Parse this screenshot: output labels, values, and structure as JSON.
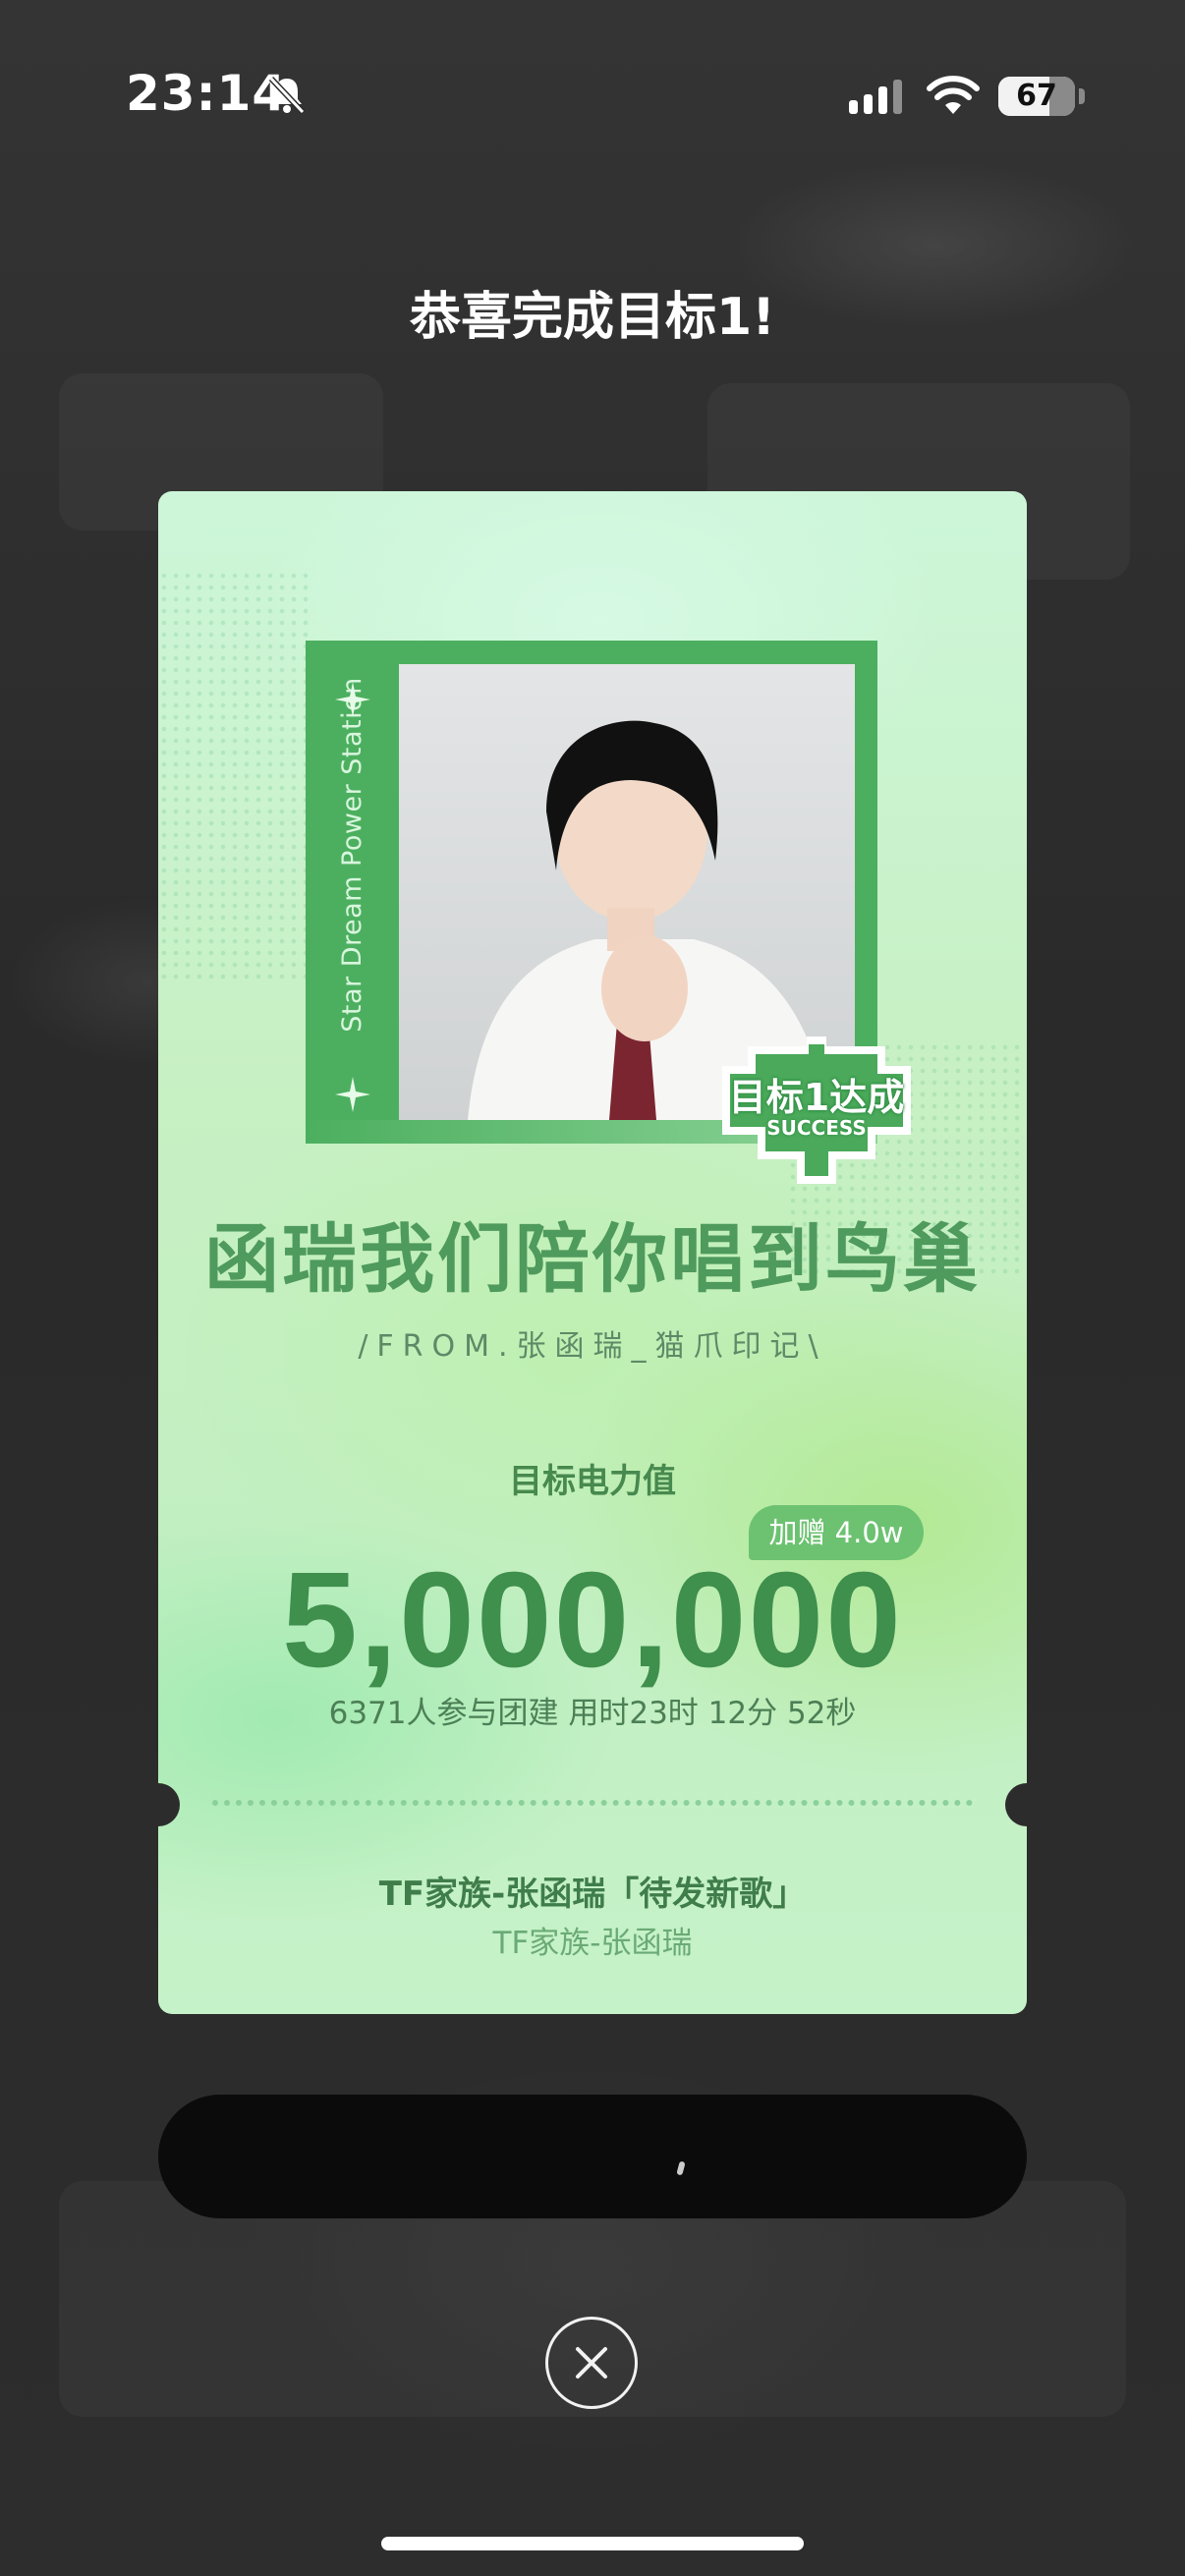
{
  "status_bar": {
    "time": "23:14",
    "battery": "67"
  },
  "headline": "恭喜完成目标1!",
  "card": {
    "frame_vertical_text": "Star Dream Power Station",
    "badge": {
      "title": "目标1达成",
      "subtitle": "SUCCESS"
    },
    "slogan": "函瑞我们陪你唱到鸟巢",
    "from": "/FROM.张函瑞_猫爪印记\\",
    "target_label": "目标电力值",
    "bonus": "加赠 4.0w",
    "target_value": "5,000,000",
    "stats": "6371人参与团建 用时23时 12分 52秒",
    "song_title": "TF家族-张函瑞「待发新歌」",
    "song_artist": "TF家族-张函瑞"
  },
  "colors": {
    "accent_green": "#3f8f4d",
    "frame_green": "#4caf5f",
    "overlay": "#2c2c2c"
  },
  "icons": [
    "bell-slash-icon",
    "signal-icon",
    "wifi-icon",
    "battery-icon",
    "sparkle-icon",
    "close-icon"
  ]
}
